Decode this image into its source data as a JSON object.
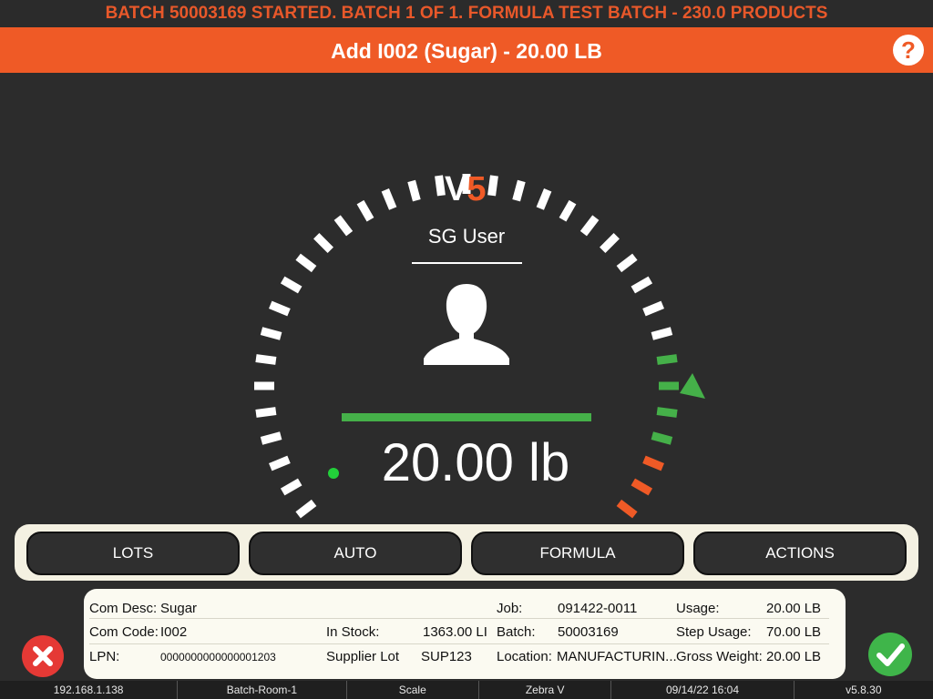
{
  "banner": {
    "text": "BATCH 50003169 STARTED. BATCH 1 OF 1. FORMULA TEST BATCH - 230.0 PRODUCTS"
  },
  "step": {
    "title": "Add I002 (Sugar) - 20.00 LB",
    "help_label": "?"
  },
  "logo": {
    "v": "V",
    "five": "5"
  },
  "user": {
    "name": "SG User"
  },
  "scale": {
    "weight": "20.00 lb",
    "progress": 1.0
  },
  "buttons": {
    "lots": "LOTS",
    "auto": "AUTO",
    "formula": "FORMULA",
    "actions": "ACTIONS"
  },
  "info": {
    "com_desc_label": "Com Desc:",
    "com_desc": "Sugar",
    "com_code_label": "Com Code:",
    "com_code": "I002",
    "lpn_label": "LPN:",
    "lpn": "0000000000000001203",
    "in_stock_label": "In Stock:",
    "in_stock": "1363.00 LI",
    "supplier_lot_label": "Supplier Lot",
    "supplier_lot": "SUP123",
    "job_label": "Job:",
    "job": "091422-0011",
    "batch_label": "Batch:",
    "batch": "50003169",
    "location_label": "Location:",
    "location": "MANUFACTURIN...",
    "usage_label": "Usage:",
    "usage": "20.00 LB",
    "step_usage_label": "Step Usage:",
    "step_usage": "70.00 LB",
    "gross_weight_label": "Gross Weight:",
    "gross_weight": "20.00 LB"
  },
  "status": {
    "ip": "192.168.1.138",
    "room": "Batch-Room-1",
    "device": "Scale",
    "printer": "Zebra V",
    "datetime": "09/14/22 16:04",
    "version": "v5.8.30"
  },
  "colors": {
    "accent": "#ef5a26",
    "ok": "#3fb54a",
    "cancel": "#e53935",
    "tolerance_green": "#45b049",
    "tolerance_over": "#ef5a26"
  }
}
